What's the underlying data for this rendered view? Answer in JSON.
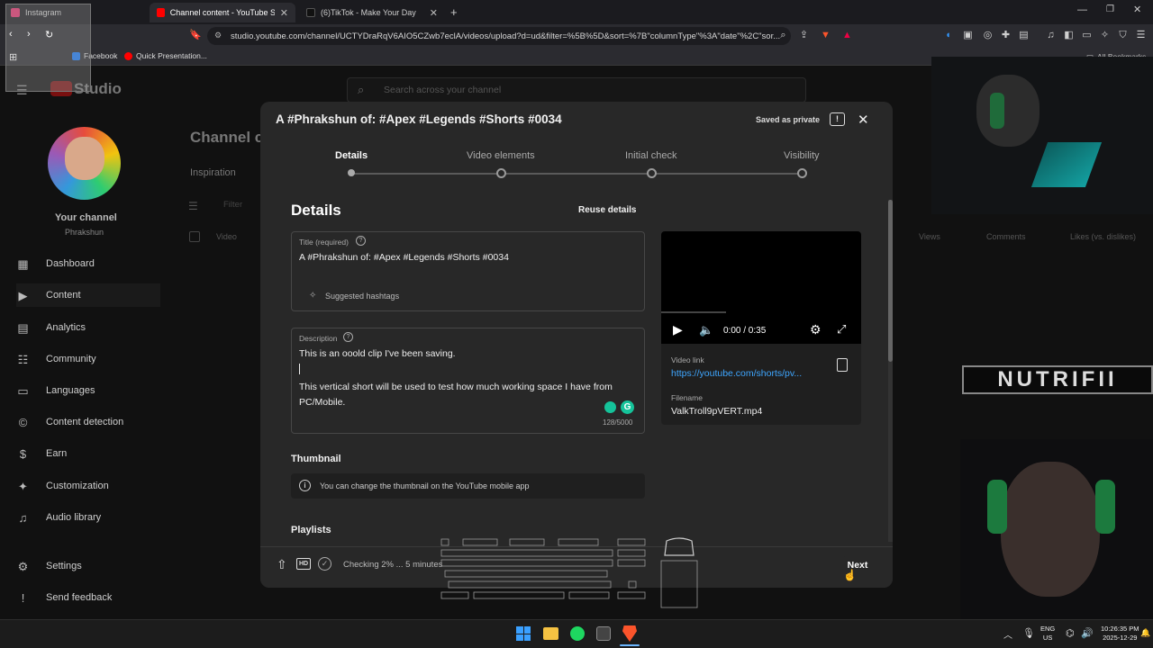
{
  "browser": {
    "tabs": [
      {
        "label": "Instagram",
        "active": false,
        "color": "#e1306c"
      },
      {
        "label": "Channel content - YouTube Studi",
        "active": true,
        "color": "#ff0000"
      },
      {
        "label": "(6)TikTok - Make Your Day",
        "active": false,
        "color": "#000000"
      }
    ],
    "url": "studio.youtube.com/channel/UCTYDraRqV6AIO5CZwb7eclA/videos/upload?d=ud&filter=%5B%5D&sort=%7B\"columnType\"%3A\"date\"%2C\"sor...",
    "bookmarks": [
      "Facebook",
      "Quick Presentation..."
    ],
    "all_bookmarks": "All Bookmarks"
  },
  "studio": {
    "logo": "Studio",
    "search_placeholder": "Search across your channel",
    "page_title": "Channel c",
    "tab_inspiration": "Inspiration",
    "filter": "Filter",
    "col_video": "Video",
    "col_views": "Views",
    "col_comments": "Comments",
    "col_likes": "Likes (vs. dislikes)",
    "your_channel": "Your channel",
    "channel_name": "Phrakshun",
    "nav": [
      {
        "label": "Dashboard",
        "icon": "dashboard-icon",
        "glyph": "▦"
      },
      {
        "label": "Content",
        "icon": "content-icon",
        "glyph": "▶"
      },
      {
        "label": "Analytics",
        "icon": "analytics-icon",
        "glyph": "▤"
      },
      {
        "label": "Community",
        "icon": "community-icon",
        "glyph": "☷"
      },
      {
        "label": "Languages",
        "icon": "languages-icon",
        "glyph": "▭"
      },
      {
        "label": "Content detection",
        "icon": "content-detection-icon",
        "glyph": "©"
      },
      {
        "label": "Earn",
        "icon": "earn-icon",
        "glyph": "$"
      },
      {
        "label": "Customization",
        "icon": "customization-icon",
        "glyph": "✦"
      },
      {
        "label": "Audio library",
        "icon": "audio-library-icon",
        "glyph": "♫"
      }
    ],
    "settings": "Settings",
    "feedback": "Send feedback"
  },
  "modal": {
    "title": "A #Phrakshun of: #Apex #Legends #Shorts #0034",
    "saved_status": "Saved as private",
    "steps": [
      "Details",
      "Video elements",
      "Initial check",
      "Visibility"
    ],
    "section_heading": "Details",
    "reuse_details": "Reuse details",
    "title_label": "Title (required)",
    "title_value": "A #Phrakshun of: #Apex #Legends #Shorts #0034",
    "suggested_hashtags": "Suggested hashtags",
    "description_label": "Description",
    "description_line1": "This is an ooold clip I've been saving.",
    "description_line2": "This vertical short will be used to test how much working space I have from PC/Mobile.",
    "description_count": "128/5000",
    "player_time": "0:00 / 0:35",
    "video_link_label": "Video link",
    "video_link": "https://youtube.com/shorts/pv...",
    "filename_label": "Filename",
    "filename": "ValkTroll9pVERT.mp4",
    "thumbnail_heading": "Thumbnail",
    "thumbnail_note": "You can change the thumbnail on the YouTube mobile app",
    "playlists_heading": "Playlists",
    "checking_status": "Checking 2% ... 5 minutes",
    "hd_badge": "HD",
    "next_button": "Next"
  },
  "overlay": {
    "nutri_text": "NUTRIFII"
  },
  "taskbar": {
    "lang_top": "ENG",
    "lang_bottom": "US",
    "time": "10:26:35 PM",
    "date": "2025-12-29"
  }
}
